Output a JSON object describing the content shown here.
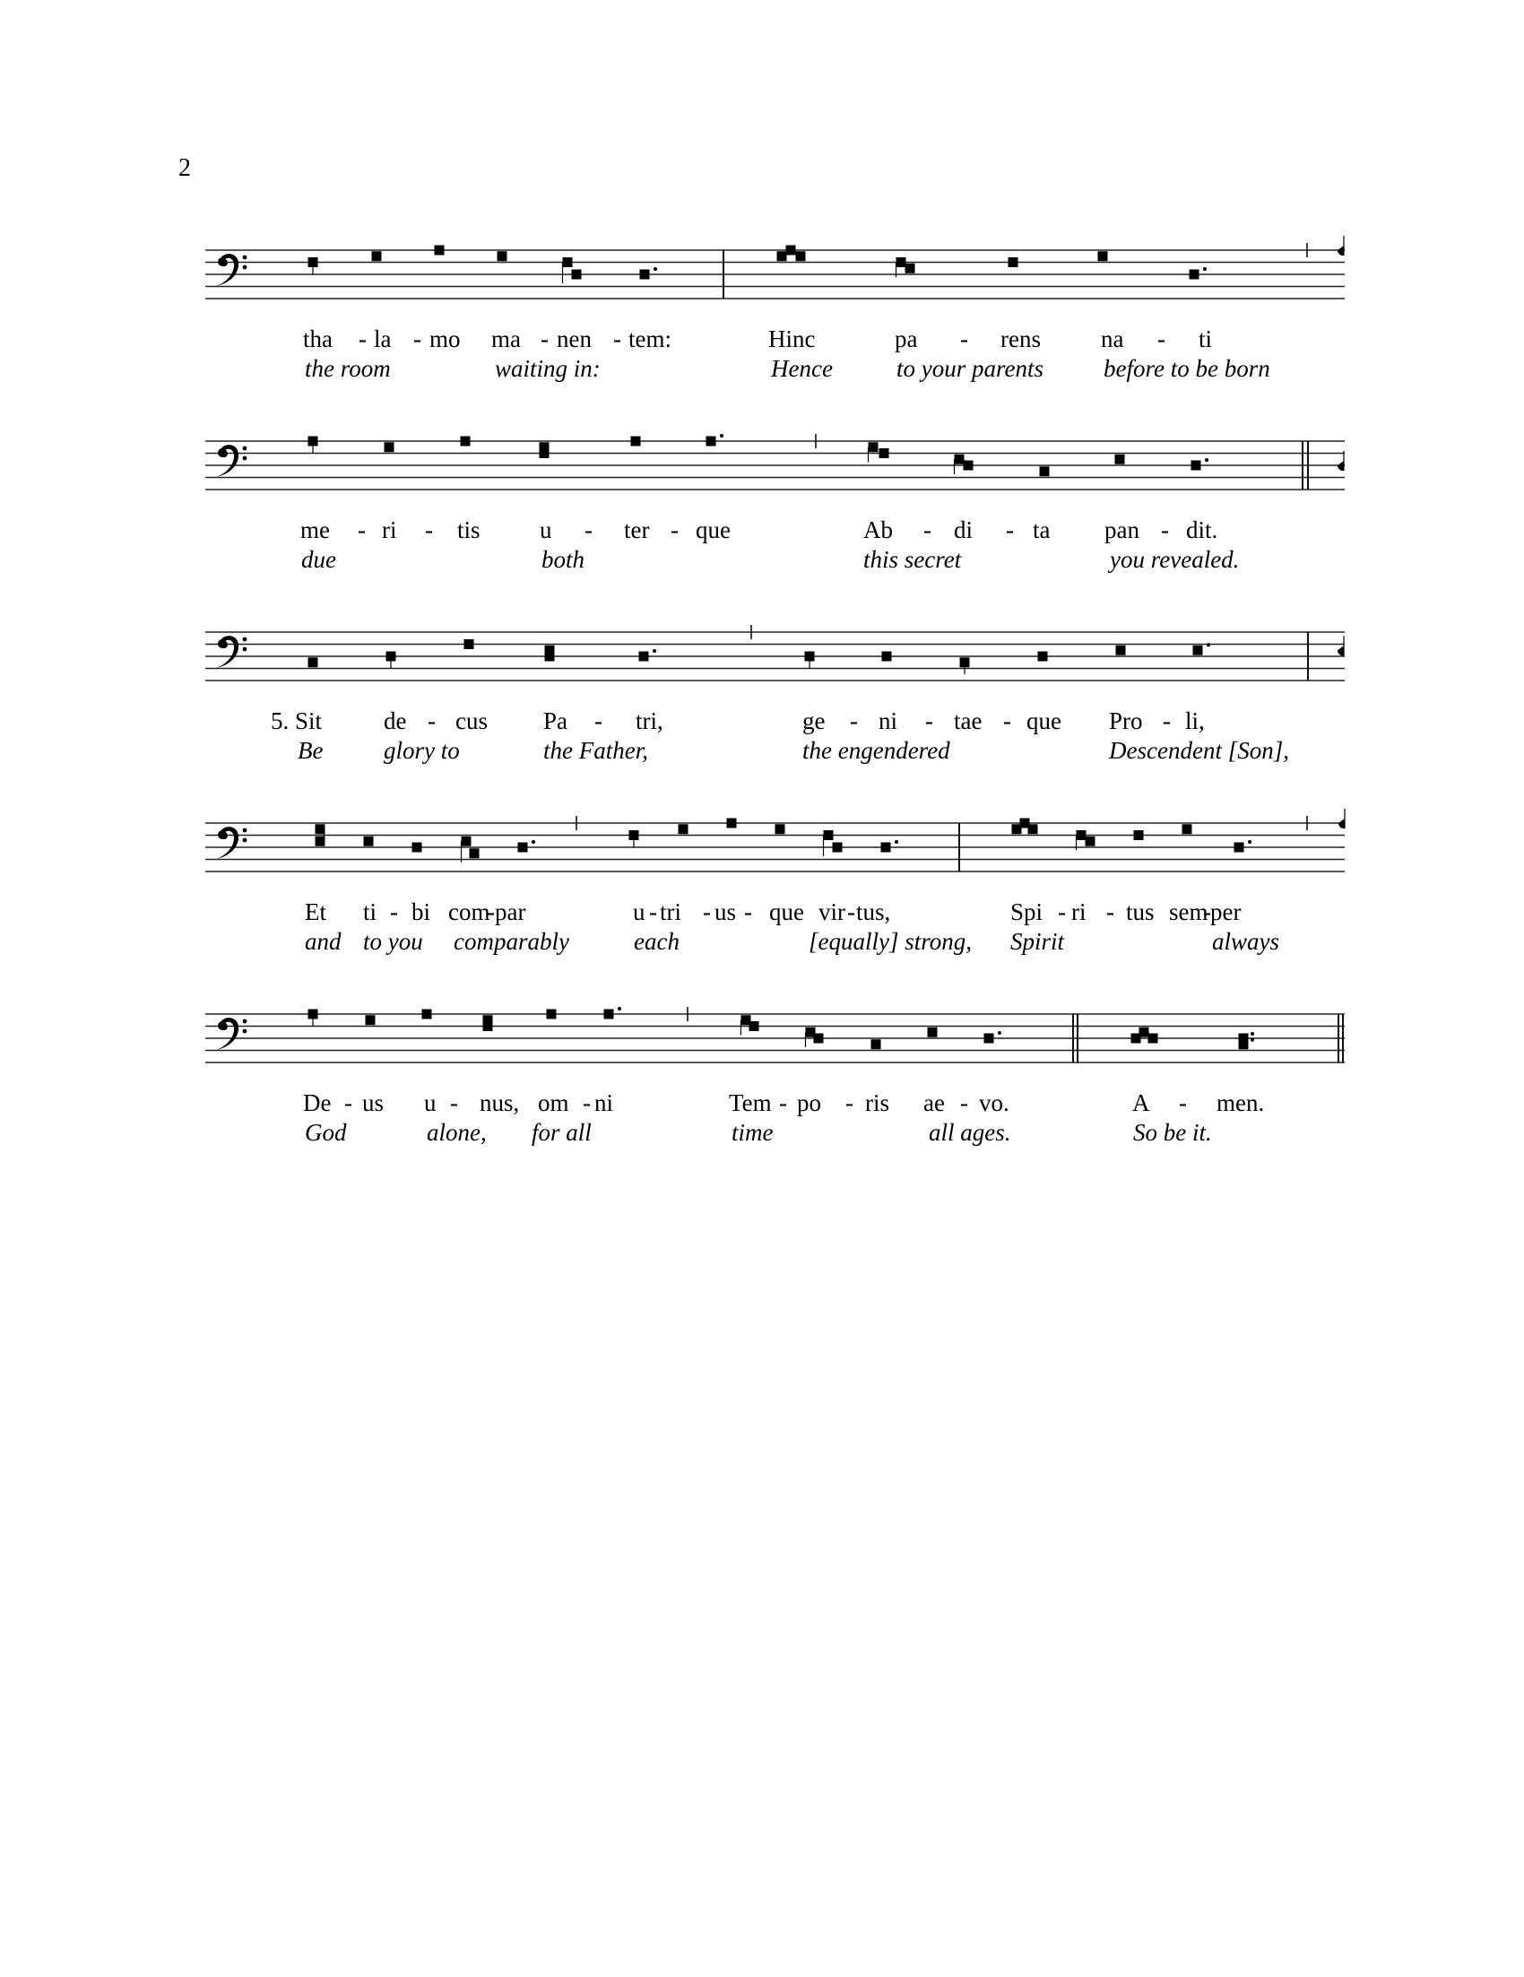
{
  "page": {
    "number": "2"
  },
  "systems": [
    {
      "clef": "F-clef (bass)",
      "elements": [
        {
          "type": "punctum",
          "pitch": [
            2
          ],
          "stem": true
        },
        {
          "type": "punctum",
          "pitch": [
            1
          ]
        },
        {
          "type": "punctum",
          "pitch": [
            0
          ]
        },
        {
          "type": "punctum",
          "pitch": [
            1
          ]
        },
        {
          "type": "clivis",
          "pitch": [
            2,
            4
          ]
        },
        {
          "type": "punctum",
          "pitch": [
            4
          ],
          "dot": true
        },
        {
          "type": "bar-half"
        },
        {
          "type": "torculus",
          "pitch": [
            1,
            0,
            1
          ]
        },
        {
          "type": "clivis",
          "pitch": [
            2,
            3
          ]
        },
        {
          "type": "punctum",
          "pitch": [
            2
          ]
        },
        {
          "type": "punctum",
          "pitch": [
            1
          ]
        },
        {
          "type": "punctum",
          "pitch": [
            4
          ],
          "dot": true
        },
        {
          "type": "bar-quarter"
        },
        {
          "type": "custos",
          "pitch": [
            0
          ]
        }
      ],
      "lyrics": [
        "tha",
        "-",
        "la",
        "-",
        "mo",
        "ma",
        "-",
        "nen",
        "-",
        "tem:",
        "Hinc",
        "pa",
        "-",
        "rens",
        "na",
        "-",
        "ti"
      ],
      "translation": [
        "the room",
        "waiting in:",
        "Hence",
        "to your parents",
        "before to be born"
      ]
    },
    {
      "clef": "F-clef (bass)",
      "elements": [
        {
          "type": "punctum",
          "pitch": [
            0
          ],
          "stem": true
        },
        {
          "type": "punctum",
          "pitch": [
            1
          ]
        },
        {
          "type": "punctum",
          "pitch": [
            0
          ]
        },
        {
          "type": "pes",
          "pitch": [
            2,
            1
          ]
        },
        {
          "type": "punctum",
          "pitch": [
            0
          ]
        },
        {
          "type": "punctum",
          "pitch": [
            0
          ],
          "dot": true
        },
        {
          "type": "bar-quarter"
        },
        {
          "type": "clivis",
          "pitch": [
            1,
            2
          ]
        },
        {
          "type": "clivis",
          "pitch": [
            3,
            4
          ]
        },
        {
          "type": "punctum",
          "pitch": [
            5
          ]
        },
        {
          "type": "punctum",
          "pitch": [
            3
          ]
        },
        {
          "type": "punctum",
          "pitch": [
            4
          ],
          "dot": true
        },
        {
          "type": "bar-double"
        },
        {
          "type": "custos",
          "pitch": [
            4
          ]
        }
      ],
      "lyrics": [
        "me",
        "-",
        "ri",
        "-",
        "tis",
        "u",
        "-",
        "ter",
        "-",
        "que",
        "Ab",
        "-",
        "di",
        "-",
        "ta",
        "pan",
        "-",
        "dit."
      ],
      "translation": [
        "due",
        "both",
        "this secret",
        "you revealed."
      ]
    },
    {
      "clef": "F-clef (bass)",
      "elements": [
        {
          "type": "punctum",
          "pitch": [
            5
          ]
        },
        {
          "type": "punctum",
          "pitch": [
            4
          ],
          "stem": true
        },
        {
          "type": "punctum",
          "pitch": [
            2
          ]
        },
        {
          "type": "pes",
          "pitch": [
            4,
            3
          ]
        },
        {
          "type": "punctum",
          "pitch": [
            4
          ],
          "dot": true
        },
        {
          "type": "bar-quarter"
        },
        {
          "type": "punctum",
          "pitch": [
            4
          ],
          "stem": true
        },
        {
          "type": "punctum",
          "pitch": [
            4
          ]
        },
        {
          "type": "punctum",
          "pitch": [
            5
          ],
          "stem": true
        },
        {
          "type": "punctum",
          "pitch": [
            4
          ]
        },
        {
          "type": "punctum",
          "pitch": [
            3
          ]
        },
        {
          "type": "punctum",
          "pitch": [
            3
          ],
          "dot": true
        },
        {
          "type": "bar-half"
        },
        {
          "type": "custos",
          "pitch": [
            3
          ]
        }
      ],
      "lyrics": [
        "5. Sit",
        "de",
        "-",
        "cus",
        "Pa",
        "-",
        "tri,",
        "ge",
        "-",
        "ni",
        "-",
        "tae",
        "-",
        "que",
        "Pro",
        "-",
        "li,"
      ],
      "translation": [
        "Be",
        "glory to",
        "the Father,",
        "the engendered",
        "Descendent [Son],"
      ]
    },
    {
      "clef": "F-clef (bass)",
      "elements": [
        {
          "type": "pes",
          "pitch": [
            3,
            1
          ]
        },
        {
          "type": "punctum",
          "pitch": [
            3
          ]
        },
        {
          "type": "punctum",
          "pitch": [
            4
          ]
        },
        {
          "type": "clivis",
          "pitch": [
            3,
            5
          ]
        },
        {
          "type": "punctum",
          "pitch": [
            4
          ],
          "dot": true
        },
        {
          "type": "bar-quarter"
        },
        {
          "type": "punctum",
          "pitch": [
            2
          ],
          "stem": true
        },
        {
          "type": "punctum",
          "pitch": [
            1
          ]
        },
        {
          "type": "punctum",
          "pitch": [
            0
          ]
        },
        {
          "type": "punctum",
          "pitch": [
            1
          ]
        },
        {
          "type": "clivis",
          "pitch": [
            2,
            4
          ]
        },
        {
          "type": "punctum",
          "pitch": [
            4
          ],
          "dot": true
        },
        {
          "type": "bar-half"
        },
        {
          "type": "torculus",
          "pitch": [
            1,
            0,
            1
          ]
        },
        {
          "type": "clivis",
          "pitch": [
            2,
            3
          ]
        },
        {
          "type": "punctum",
          "pitch": [
            2
          ]
        },
        {
          "type": "punctum",
          "pitch": [
            1
          ]
        },
        {
          "type": "punctum",
          "pitch": [
            4
          ],
          "dot": true
        },
        {
          "type": "bar-quarter"
        },
        {
          "type": "custos",
          "pitch": [
            0
          ]
        }
      ],
      "lyrics": [
        "Et",
        "ti",
        "-",
        "bi",
        "com",
        "-",
        "par",
        "u",
        "-",
        "tri",
        "-",
        "us",
        "-",
        "que",
        "vir",
        "-",
        "tus,",
        "Spi",
        "-",
        "ri",
        "-",
        "tus",
        "sem",
        "-",
        "per"
      ],
      "translation": [
        "and",
        "to you",
        "comparably",
        "each",
        "[equally] strong,",
        "Spirit",
        "always"
      ]
    },
    {
      "clef": "F-clef (bass)",
      "elements": [
        {
          "type": "punctum",
          "pitch": [
            0
          ],
          "stem": true
        },
        {
          "type": "punctum",
          "pitch": [
            1
          ]
        },
        {
          "type": "punctum",
          "pitch": [
            0
          ]
        },
        {
          "type": "pes",
          "pitch": [
            2,
            1
          ]
        },
        {
          "type": "punctum",
          "pitch": [
            0
          ]
        },
        {
          "type": "punctum",
          "pitch": [
            0
          ],
          "dot": true
        },
        {
          "type": "bar-quarter"
        },
        {
          "type": "clivis",
          "pitch": [
            1,
            2
          ]
        },
        {
          "type": "clivis",
          "pitch": [
            3,
            4
          ]
        },
        {
          "type": "punctum",
          "pitch": [
            5
          ]
        },
        {
          "type": "punctum",
          "pitch": [
            3
          ]
        },
        {
          "type": "punctum",
          "pitch": [
            4
          ],
          "dot": true
        },
        {
          "type": "bar-double"
        },
        {
          "type": "torculus",
          "pitch": [
            4,
            3,
            4
          ]
        },
        {
          "type": "pes",
          "pitch": [
            5,
            4
          ],
          "dot": true
        },
        {
          "type": "bar-final"
        }
      ],
      "lyrics": [
        "De",
        "-",
        "us",
        "u",
        "-",
        "nus,",
        "om",
        "-",
        "ni",
        "Tem",
        "-",
        "po",
        "-",
        "ris",
        "ae",
        "-",
        "vo.",
        "A",
        "-",
        "men."
      ],
      "translation": [
        "God",
        "alone,",
        "for all",
        "time",
        "all ages.",
        "So be it."
      ]
    }
  ]
}
